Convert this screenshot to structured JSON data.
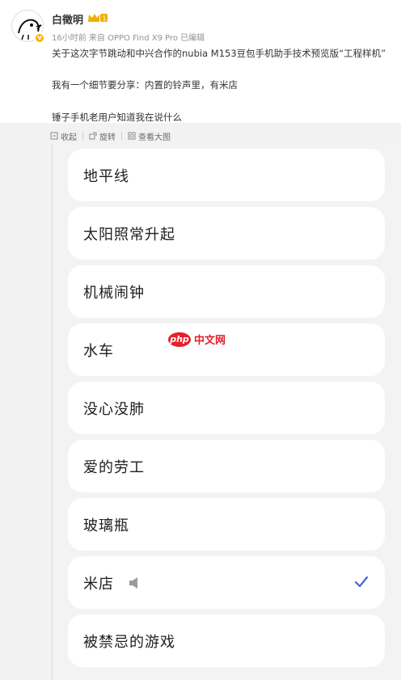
{
  "post": {
    "username": "白徵明",
    "meta": "16小时前 来自 OPPO Find X9 Pro 已编辑",
    "lines": [
      "关于这次字节跳动和中兴合作的nubia M153豆包手机助手技术预览版“工程样机”",
      "我有一个细节要分享：内置的铃声里，有米店",
      "锤子手机老用户知道我在说什么"
    ]
  },
  "toolbar": {
    "collapse": "收起",
    "rotate": "旋转",
    "view_large": "查看大图"
  },
  "ringtones": [
    {
      "label": "地平线",
      "selected": false
    },
    {
      "label": "太阳照常升起",
      "selected": false
    },
    {
      "label": "机械闹钟",
      "selected": false
    },
    {
      "label": "水车",
      "selected": false
    },
    {
      "label": "没心没肺",
      "selected": false
    },
    {
      "label": "爱的劳工",
      "selected": false
    },
    {
      "label": "玻璃瓶",
      "selected": false
    },
    {
      "label": "米店",
      "selected": true
    },
    {
      "label": "被禁忌的游戏",
      "selected": false
    }
  ],
  "watermark": {
    "logo": "php",
    "text": "中文网"
  },
  "colors": {
    "check": "#4a65d6",
    "watermark": "#e3202b",
    "badge": "#f8b700"
  }
}
